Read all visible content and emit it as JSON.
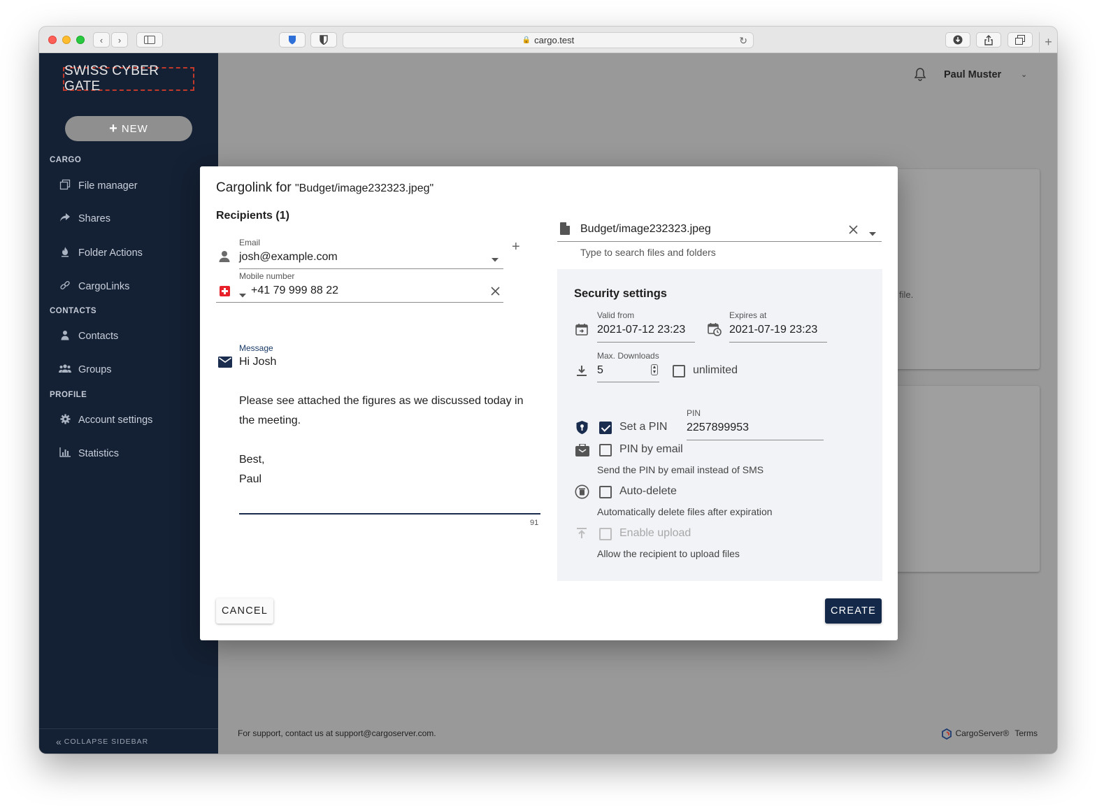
{
  "browser": {
    "url": "cargo.test"
  },
  "sidebar": {
    "logo": "SWISS CYBER GATE",
    "new_button": "NEW",
    "sections": {
      "cargo": "CARGO",
      "contacts": "CONTACTS",
      "profile": "PROFILE"
    },
    "items": {
      "file_manager": "File manager",
      "shares": "Shares",
      "folder_actions": "Folder Actions",
      "cargolinks": "CargoLinks",
      "contacts": "Contacts",
      "groups": "Groups",
      "account_settings": "Account settings",
      "statistics": "Statistics"
    },
    "collapse": "COLLAPSE SIDEBAR"
  },
  "header": {
    "user_name": "Paul Muster"
  },
  "background": {
    "card_text": "file."
  },
  "footer": {
    "support": "For support, contact us at support@cargoserver.com.",
    "brand": "CargoServer®",
    "terms": "Terms"
  },
  "dialog": {
    "title": "Cargolink for",
    "title_file": "\"Budget/image232323.jpeg\"",
    "recipients_heading": "Recipients (1)",
    "email": {
      "label": "Email",
      "value": "josh@example.com"
    },
    "mobile": {
      "label": "Mobile number",
      "value": "+41 79 999 88 22"
    },
    "message": {
      "label": "Message",
      "lines": [
        "Hi Josh",
        "",
        "Please see attached the figures as we discussed today in the meeting.",
        "",
        "Best,",
        "Paul"
      ],
      "char_count": "91"
    },
    "file_select": {
      "value": "Budget/image232323.jpeg",
      "helper": "Type to search files and folders"
    },
    "security": {
      "title": "Security settings",
      "valid_from": {
        "label": "Valid from",
        "value": "2021-07-12 23:23"
      },
      "expires_at": {
        "label": "Expires at",
        "value": "2021-07-19 23:23"
      },
      "max_downloads": {
        "label": "Max. Downloads",
        "value": "5"
      },
      "unlimited": {
        "label": "unlimited",
        "checked": false
      },
      "set_pin": {
        "label": "Set a PIN",
        "checked": true
      },
      "pin": {
        "label": "PIN",
        "value": "2257899953"
      },
      "pin_by_email": {
        "label": "PIN by email",
        "checked": false,
        "helper": "Send the PIN by email instead of SMS"
      },
      "auto_delete": {
        "label": "Auto-delete",
        "checked": false,
        "helper": "Automatically delete files after expiration"
      },
      "enable_upload": {
        "label": "Enable upload",
        "checked": false,
        "disabled": true,
        "helper": "Allow the recipient to upload files"
      }
    },
    "buttons": {
      "cancel": "CANCEL",
      "create": "CREATE"
    }
  }
}
